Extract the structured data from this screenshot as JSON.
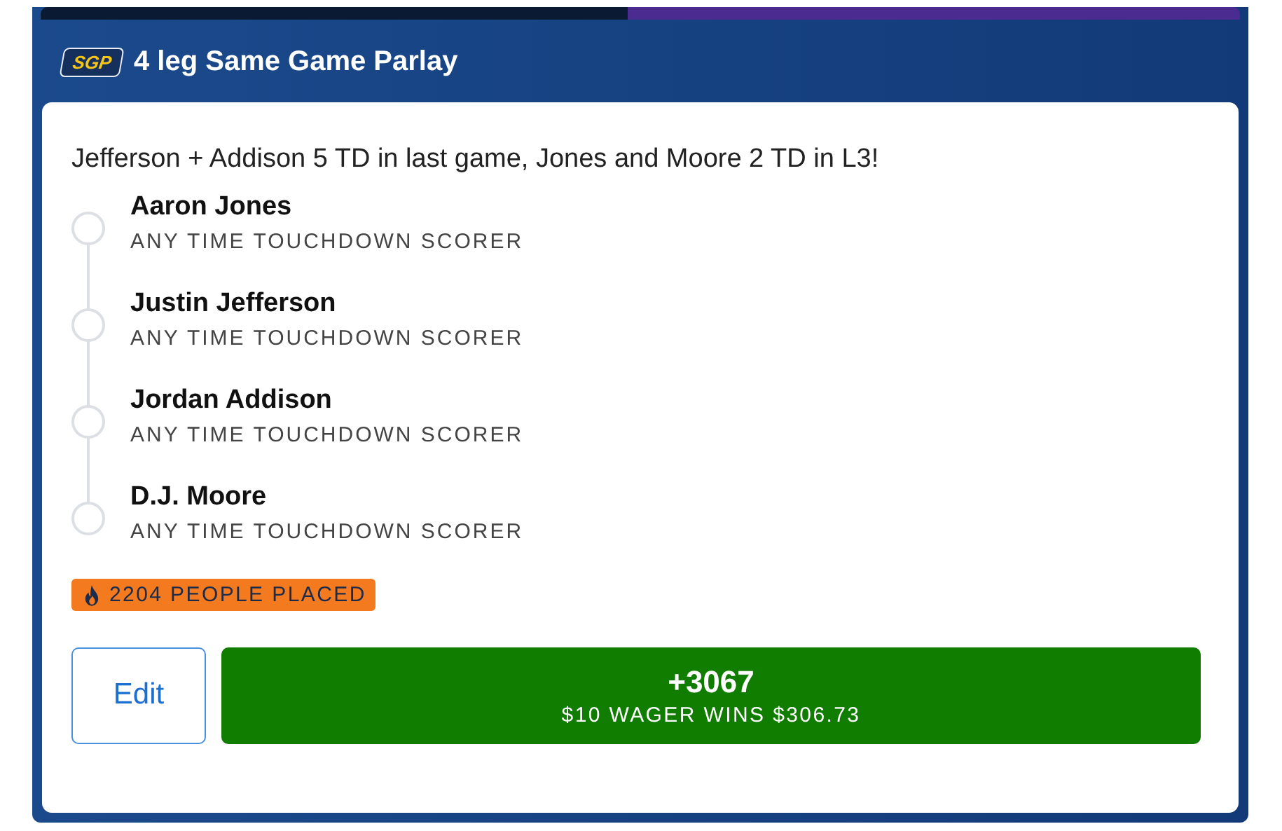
{
  "header": {
    "badge": "SGP",
    "title": "4 leg Same Game Parlay"
  },
  "description": "Jefferson + Addison 5 TD in last game, Jones and Moore 2 TD in L3!",
  "legs": [
    {
      "player": "Aaron Jones",
      "market": "ANY TIME TOUCHDOWN SCORER",
      "checked": false
    },
    {
      "player": "Justin Jefferson",
      "market": "ANY TIME TOUCHDOWN SCORER",
      "checked": false
    },
    {
      "player": "Jordan Addison",
      "market": "ANY TIME TOUCHDOWN SCORER",
      "checked": false
    },
    {
      "player": "D.J. Moore",
      "market": "ANY TIME TOUCHDOWN SCORER",
      "checked": false
    }
  ],
  "popularity": "2204 PEOPLE PLACED",
  "edit_button": "Edit",
  "bet_button": {
    "odds": "+3067",
    "payout": "$10 WAGER WINS $306.73"
  }
}
